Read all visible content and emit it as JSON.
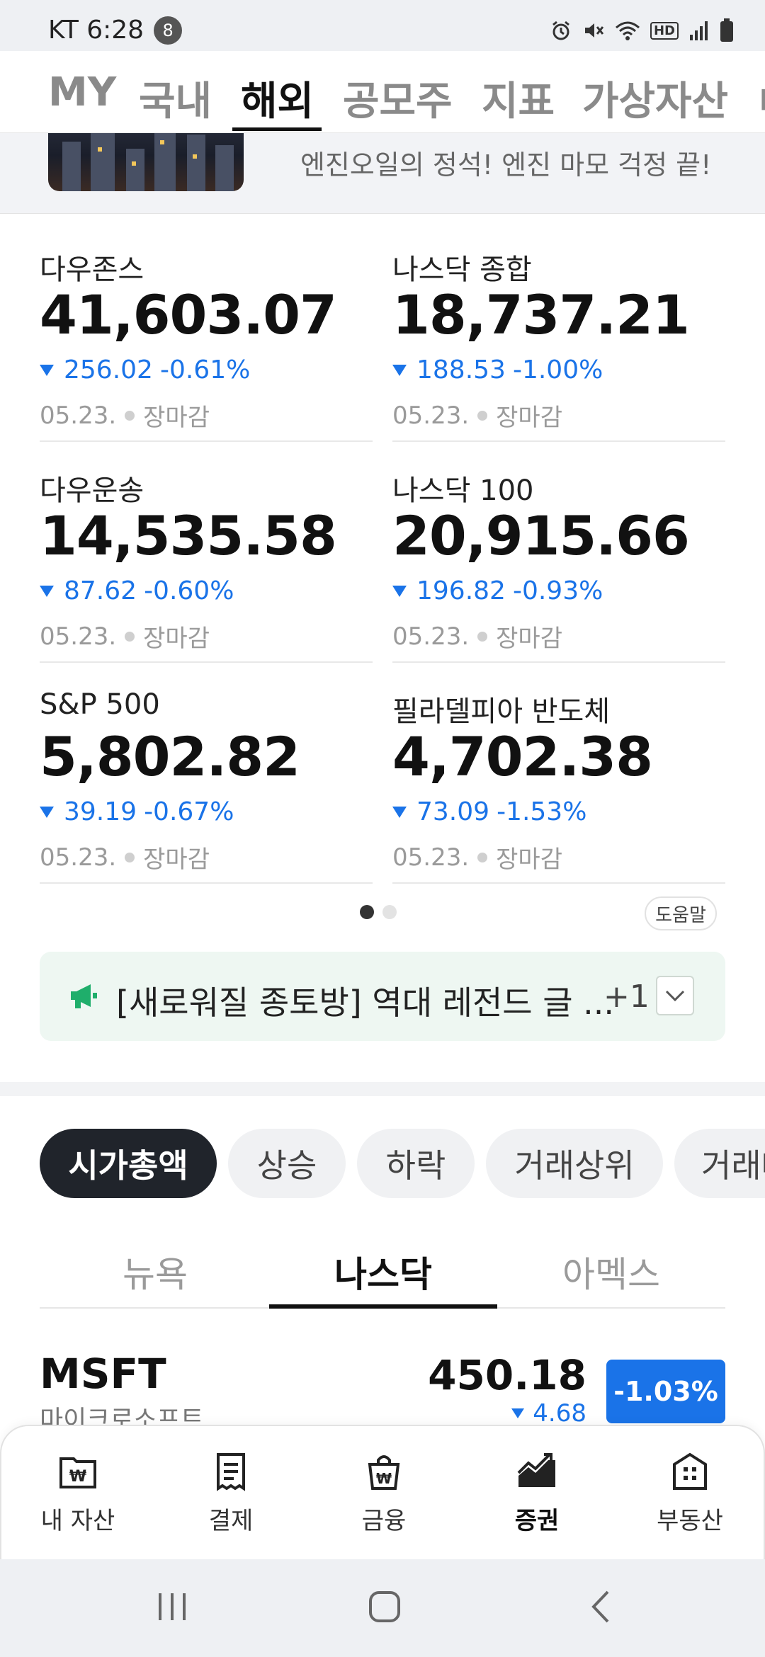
{
  "status_bar": {
    "carrier_time": "KT 6:28",
    "notification_count": "8",
    "hd_label": "HD"
  },
  "top_tabs": [
    {
      "label": "MY"
    },
    {
      "label": "국내"
    },
    {
      "label": "해외",
      "active": true
    },
    {
      "label": "공모주"
    },
    {
      "label": "지표"
    },
    {
      "label": "가상자산"
    }
  ],
  "banner": {
    "text": "엔진오일의 정석! 엔진 마모 걱정 끝!"
  },
  "indices": [
    {
      "name": "다우존스",
      "value": "41,603.07",
      "change": "256.02",
      "rate": "-0.61%",
      "date": "05.23.",
      "status": "장마감"
    },
    {
      "name": "나스닥 종합",
      "value": "18,737.21",
      "change": "188.53",
      "rate": "-1.00%",
      "date": "05.23.",
      "status": "장마감"
    },
    {
      "name": "다우운송",
      "value": "14,535.58",
      "change": "87.62",
      "rate": "-0.60%",
      "date": "05.23.",
      "status": "장마감"
    },
    {
      "name": "나스닥 100",
      "value": "20,915.66",
      "change": "196.82",
      "rate": "-0.93%",
      "date": "05.23.",
      "status": "장마감"
    },
    {
      "name": "S&P 500",
      "value": "5,802.82",
      "change": "39.19",
      "rate": "-0.67%",
      "date": "05.23.",
      "status": "장마감"
    },
    {
      "name": "필라델피아 반도체",
      "value": "4,702.38",
      "change": "73.09",
      "rate": "-1.53%",
      "date": "05.23.",
      "status": "장마감"
    }
  ],
  "help_label": "도움말",
  "pager": {
    "current": 1,
    "total": 2
  },
  "notice": {
    "text": "[새로워질 종토방] 역대 레전드 글 ...",
    "count": "+1"
  },
  "chips": [
    {
      "label": "시가총액",
      "active": true
    },
    {
      "label": "상승"
    },
    {
      "label": "하락"
    },
    {
      "label": "거래상위"
    },
    {
      "label": "거래대"
    }
  ],
  "exchange_tabs": [
    {
      "label": "뉴욕"
    },
    {
      "label": "나스닥",
      "active": true
    },
    {
      "label": "아멕스"
    }
  ],
  "stock": {
    "ticker": "MSFT",
    "name": "마이크로소프트",
    "price": "450.18",
    "change": "4.68",
    "rate": "-1.03%"
  },
  "bottom_nav": [
    {
      "label": "내 자산",
      "icon": "wallet-won-icon"
    },
    {
      "label": "결제",
      "icon": "receipt-icon"
    },
    {
      "label": "금융",
      "icon": "shopping-bag-won-icon"
    },
    {
      "label": "증권",
      "icon": "stock-chart-icon",
      "active": true
    },
    {
      "label": "부동산",
      "icon": "building-icon"
    }
  ],
  "colors": {
    "down_blue": "#1a73e8",
    "chip_active_bg": "#20242b",
    "notice_bg": "#eef7f2",
    "notice_icon": "#1fae6b"
  }
}
